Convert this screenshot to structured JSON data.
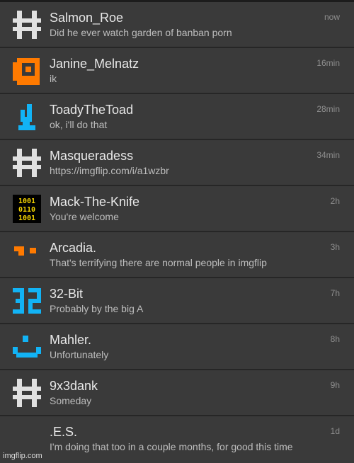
{
  "conversations": [
    {
      "name": "Salmon_Roe",
      "message": "Did he ever watch garden of banban porn",
      "time": "now",
      "avatar": "gray-hash-icon"
    },
    {
      "name": "Janine_Melnatz",
      "message": "ik",
      "time": "16min",
      "avatar": "orange-ring-icon"
    },
    {
      "name": "ToadyTheToad",
      "message": "ok, i'll do that",
      "time": "28min",
      "avatar": "blue-toad-icon"
    },
    {
      "name": "Masqueradess",
      "message": "https://imgflip.com/i/a1wzbr",
      "time": "34min",
      "avatar": "gray-hash-icon"
    },
    {
      "name": "Mack-The-Knife",
      "message": "You're welcome",
      "time": "2h",
      "avatar": "binary-avatar-icon"
    },
    {
      "name": "Arcadia.",
      "message": "That's terrifying there are normal people in imgflip",
      "time": "3h",
      "avatar": "orange-blocks-icon"
    },
    {
      "name": "32-Bit",
      "message": "Probably by the big A",
      "time": "7h",
      "avatar": "blue-32-icon"
    },
    {
      "name": "Mahler.",
      "message": "Unfortunately",
      "time": "8h",
      "avatar": "blue-smile-icon"
    },
    {
      "name": "9x3dank",
      "message": "Someday",
      "time": "9h",
      "avatar": "gray-hash-icon"
    },
    {
      "name": ".E.S.",
      "message": "I'm doing that too in a couple months, for good this time",
      "time": "1d",
      "avatar": "none"
    }
  ],
  "avatar_binary": [
    "1001",
    "0110",
    "1001"
  ],
  "watermark": "imgflip.com",
  "colors": {
    "background": "#3a3a3a",
    "separator": "#262626",
    "orange": "#ff7a00",
    "blue": "#12b3f5",
    "gray": "#e0e0e0",
    "yellow": "#f5d400"
  }
}
